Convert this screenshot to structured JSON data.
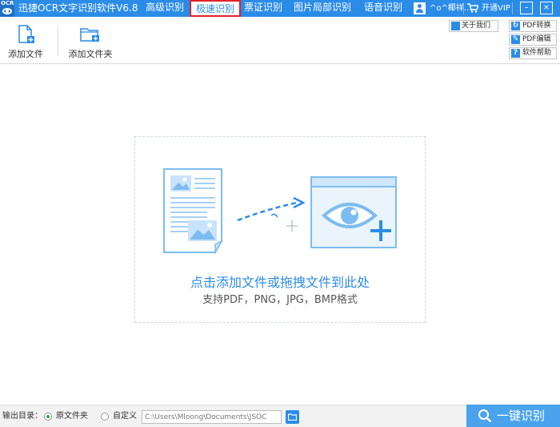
{
  "app": {
    "logo_text": "OCR",
    "title": "迅捷OCR文字识别软件V6.8"
  },
  "nav": {
    "tabs": [
      {
        "label": "高级识别",
        "active": false
      },
      {
        "label": "极速识别",
        "active": true
      },
      {
        "label": "票证识别",
        "active": false
      },
      {
        "label": "图片局部识别",
        "active": false
      },
      {
        "label": "语音识别",
        "active": false
      }
    ]
  },
  "user": {
    "name": "^o^椰祥...",
    "vip_label": "开通VIP"
  },
  "window_controls": {
    "minimize": "–",
    "close": "×"
  },
  "toolbar": {
    "add_file": "添加文件",
    "add_folder": "添加文件夹",
    "about": "关于我们",
    "side": [
      "PDF转换",
      "PDF编辑",
      "软件帮助"
    ]
  },
  "dropzone": {
    "title": "点击添加文件或拖拽文件到此处",
    "subtitle": "支持PDF，PNG，JPG，BMP格式"
  },
  "output": {
    "label": "输出目录：",
    "option_original": "原文件夹",
    "option_custom": "自定义",
    "selected": "原文件夹",
    "path": "C:\\Users\\Mloong\\Documents\\JSOC"
  },
  "ocr_button": "一键识别",
  "colors": {
    "accent": "#2b8ce8",
    "active_border": "#e0242b",
    "radio_selected": "#35a94b"
  }
}
